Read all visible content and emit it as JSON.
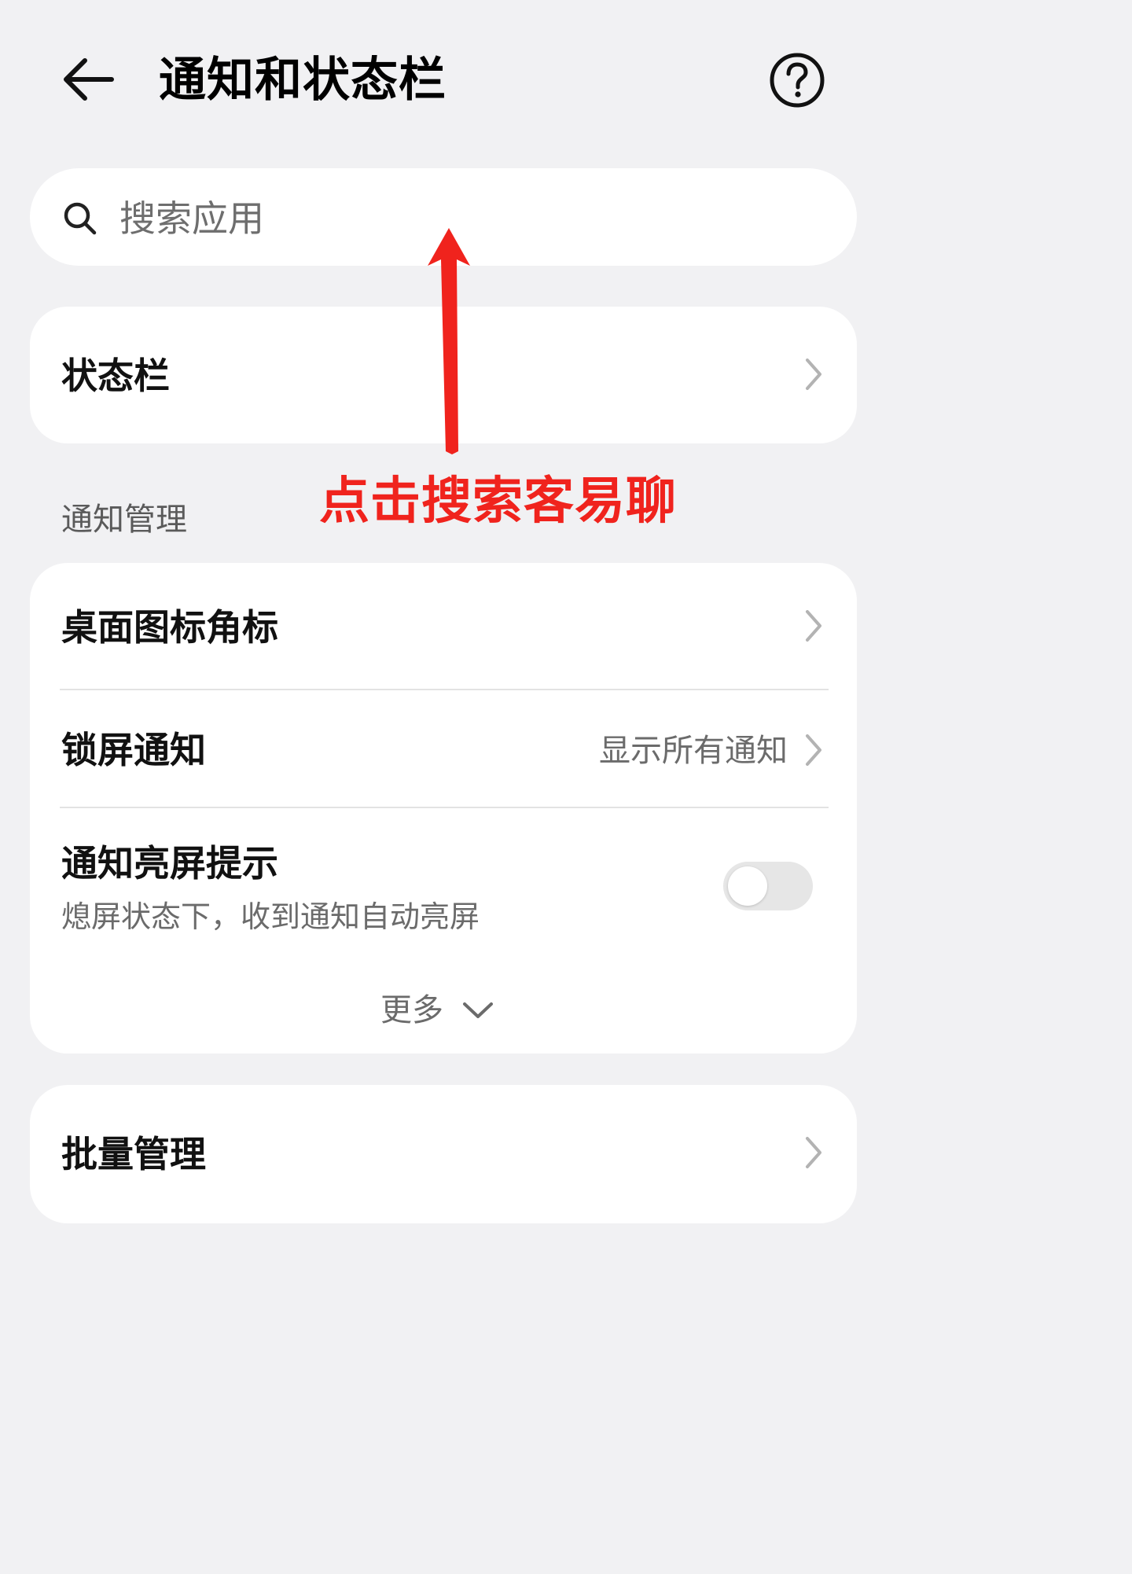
{
  "header": {
    "title": "通知和状态栏",
    "back_icon": "arrow-left-icon",
    "help_icon": "question-circle-icon"
  },
  "search": {
    "placeholder": "搜索应用",
    "icon": "search-icon"
  },
  "status_bar_card": {
    "label": "状态栏"
  },
  "notification_management": {
    "section_label": "通知管理",
    "rows": [
      {
        "label": "桌面图标角标"
      },
      {
        "label": "锁屏通知",
        "value": "显示所有通知"
      },
      {
        "label": "通知亮屏提示",
        "subtitle": "熄屏状态下，收到通知自动亮屏",
        "toggle_on": false
      }
    ],
    "more_label": "更多"
  },
  "batch_card": {
    "label": "批量管理"
  },
  "annotation": {
    "text": "点击搜索客易聊",
    "color": "#f0231d"
  },
  "colors": {
    "background": "#f1f1f3",
    "card": "#ffffff",
    "secondary_text": "#6b6b6b",
    "toggle_off": "#e6e6e6"
  }
}
